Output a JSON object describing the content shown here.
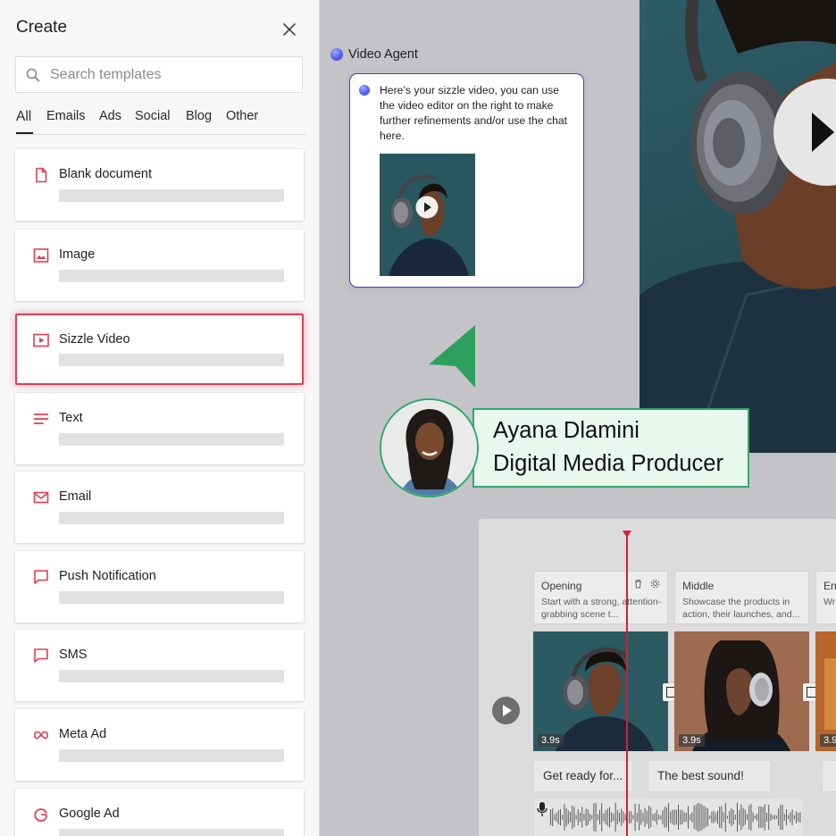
{
  "panel": {
    "title": "Create",
    "search_placeholder": "Search templates",
    "tabs": [
      "All",
      "Emails",
      "Ads",
      "Social",
      "Blog",
      "Other"
    ],
    "active_tab": "All",
    "templates": [
      {
        "label": "Blank document",
        "icon": "document-icon"
      },
      {
        "label": "Image",
        "icon": "image-icon"
      },
      {
        "label": "Sizzle Video",
        "icon": "video-icon",
        "selected": true
      },
      {
        "label": "Text",
        "icon": "text-lines-icon"
      },
      {
        "label": "Email",
        "icon": "envelope-icon"
      },
      {
        "label": "Push Notification",
        "icon": "message-icon"
      },
      {
        "label": "SMS",
        "icon": "message-icon"
      },
      {
        "label": "Meta Ad",
        "icon": "meta-icon"
      },
      {
        "label": "Google Ad",
        "icon": "google-icon"
      }
    ]
  },
  "agent": {
    "label": "Video Agent",
    "message": "Here’s your sizzle video, you can use the video editor on the right to make further refinements and/or use the chat here."
  },
  "person": {
    "name": "Ayana Dlamini",
    "role": "Digital Media Producer"
  },
  "editor": {
    "segments": [
      {
        "title": "Opening",
        "desc": "Start with a strong, attention-grabbing scene t..."
      },
      {
        "title": "Middle",
        "desc": "Showcase the products in action, their launches, and..."
      },
      {
        "title": "En",
        "desc": "Wr clo"
      }
    ],
    "clips": [
      {
        "duration": "3.9s"
      },
      {
        "duration": "3.9s"
      },
      {
        "duration": "3.9"
      }
    ],
    "captions": [
      "Get ready for...",
      "The best sound!"
    ]
  },
  "colors": {
    "accent": "#e03e56",
    "agent_border": "#3b43b8",
    "badge_green": "#31a96a",
    "playhead": "#d51e3a"
  }
}
